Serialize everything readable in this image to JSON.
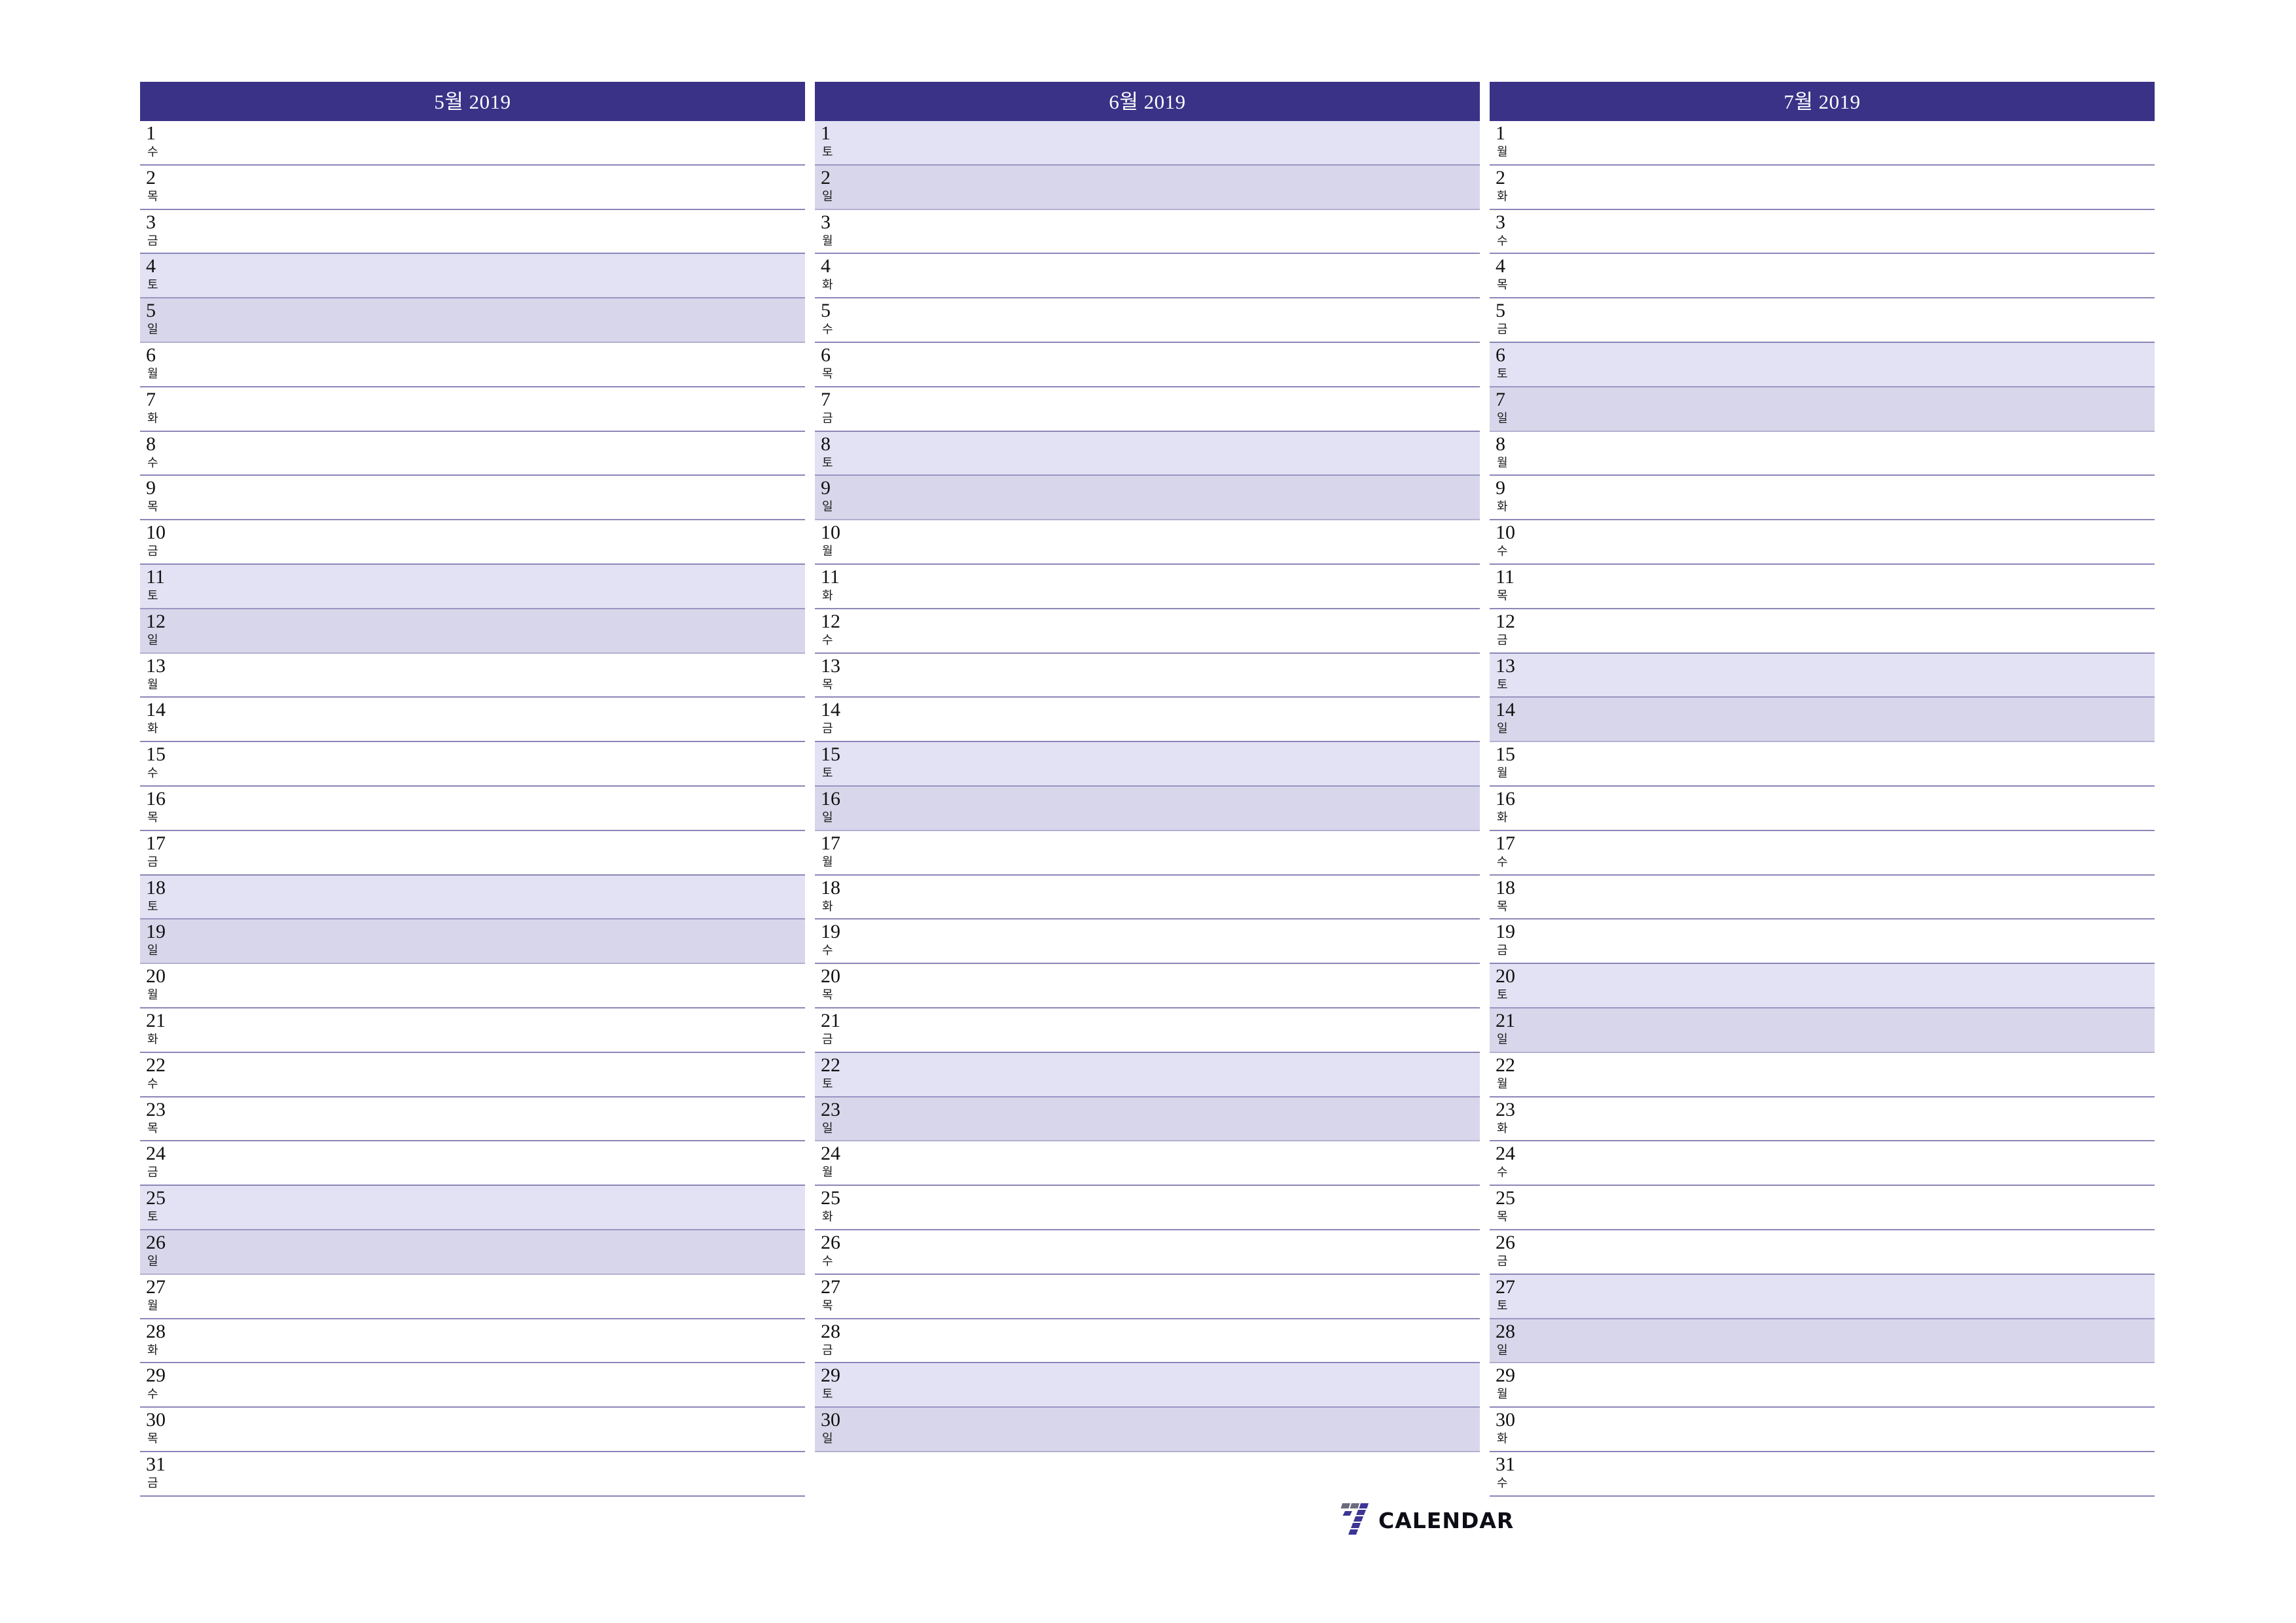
{
  "document": {
    "type": "calendar-planner",
    "layout": "three-month-columns",
    "weekday_labels": {
      "mon": "월",
      "tue": "화",
      "wed": "수",
      "thu": "목",
      "fri": "금",
      "sat": "토",
      "sun": "일"
    }
  },
  "colors": {
    "header_background": "#3a3287",
    "header_text": "#ffffff",
    "saturday_row": "#e2e2f4",
    "sunday_row": "#d8d6ea",
    "row_divider": "#8b86b8",
    "page_background": "#ffffff",
    "logo_purple": "#3d3596",
    "logo_gray": "#6b6b7d",
    "logo_text": "#0d0d16"
  },
  "months": [
    {
      "id": "may",
      "title": "5월 2019",
      "days": [
        {
          "num": "1",
          "wd": "수",
          "type": "weekday"
        },
        {
          "num": "2",
          "wd": "목",
          "type": "weekday"
        },
        {
          "num": "3",
          "wd": "금",
          "type": "weekday"
        },
        {
          "num": "4",
          "wd": "토",
          "type": "sat"
        },
        {
          "num": "5",
          "wd": "일",
          "type": "sun"
        },
        {
          "num": "6",
          "wd": "월",
          "type": "weekday"
        },
        {
          "num": "7",
          "wd": "화",
          "type": "weekday"
        },
        {
          "num": "8",
          "wd": "수",
          "type": "weekday"
        },
        {
          "num": "9",
          "wd": "목",
          "type": "weekday"
        },
        {
          "num": "10",
          "wd": "금",
          "type": "weekday"
        },
        {
          "num": "11",
          "wd": "토",
          "type": "sat"
        },
        {
          "num": "12",
          "wd": "일",
          "type": "sun"
        },
        {
          "num": "13",
          "wd": "월",
          "type": "weekday"
        },
        {
          "num": "14",
          "wd": "화",
          "type": "weekday"
        },
        {
          "num": "15",
          "wd": "수",
          "type": "weekday"
        },
        {
          "num": "16",
          "wd": "목",
          "type": "weekday"
        },
        {
          "num": "17",
          "wd": "금",
          "type": "weekday"
        },
        {
          "num": "18",
          "wd": "토",
          "type": "sat"
        },
        {
          "num": "19",
          "wd": "일",
          "type": "sun"
        },
        {
          "num": "20",
          "wd": "월",
          "type": "weekday"
        },
        {
          "num": "21",
          "wd": "화",
          "type": "weekday"
        },
        {
          "num": "22",
          "wd": "수",
          "type": "weekday"
        },
        {
          "num": "23",
          "wd": "목",
          "type": "weekday"
        },
        {
          "num": "24",
          "wd": "금",
          "type": "weekday"
        },
        {
          "num": "25",
          "wd": "토",
          "type": "sat"
        },
        {
          "num": "26",
          "wd": "일",
          "type": "sun"
        },
        {
          "num": "27",
          "wd": "월",
          "type": "weekday"
        },
        {
          "num": "28",
          "wd": "화",
          "type": "weekday"
        },
        {
          "num": "29",
          "wd": "수",
          "type": "weekday"
        },
        {
          "num": "30",
          "wd": "목",
          "type": "weekday"
        },
        {
          "num": "31",
          "wd": "금",
          "type": "weekday"
        }
      ]
    },
    {
      "id": "june",
      "title": "6월 2019",
      "days": [
        {
          "num": "1",
          "wd": "토",
          "type": "sat"
        },
        {
          "num": "2",
          "wd": "일",
          "type": "sun"
        },
        {
          "num": "3",
          "wd": "월",
          "type": "weekday"
        },
        {
          "num": "4",
          "wd": "화",
          "type": "weekday"
        },
        {
          "num": "5",
          "wd": "수",
          "type": "weekday"
        },
        {
          "num": "6",
          "wd": "목",
          "type": "weekday"
        },
        {
          "num": "7",
          "wd": "금",
          "type": "weekday"
        },
        {
          "num": "8",
          "wd": "토",
          "type": "sat"
        },
        {
          "num": "9",
          "wd": "일",
          "type": "sun"
        },
        {
          "num": "10",
          "wd": "월",
          "type": "weekday"
        },
        {
          "num": "11",
          "wd": "화",
          "type": "weekday"
        },
        {
          "num": "12",
          "wd": "수",
          "type": "weekday"
        },
        {
          "num": "13",
          "wd": "목",
          "type": "weekday"
        },
        {
          "num": "14",
          "wd": "금",
          "type": "weekday"
        },
        {
          "num": "15",
          "wd": "토",
          "type": "sat"
        },
        {
          "num": "16",
          "wd": "일",
          "type": "sun"
        },
        {
          "num": "17",
          "wd": "월",
          "type": "weekday"
        },
        {
          "num": "18",
          "wd": "화",
          "type": "weekday"
        },
        {
          "num": "19",
          "wd": "수",
          "type": "weekday"
        },
        {
          "num": "20",
          "wd": "목",
          "type": "weekday"
        },
        {
          "num": "21",
          "wd": "금",
          "type": "weekday"
        },
        {
          "num": "22",
          "wd": "토",
          "type": "sat"
        },
        {
          "num": "23",
          "wd": "일",
          "type": "sun"
        },
        {
          "num": "24",
          "wd": "월",
          "type": "weekday"
        },
        {
          "num": "25",
          "wd": "화",
          "type": "weekday"
        },
        {
          "num": "26",
          "wd": "수",
          "type": "weekday"
        },
        {
          "num": "27",
          "wd": "목",
          "type": "weekday"
        },
        {
          "num": "28",
          "wd": "금",
          "type": "weekday"
        },
        {
          "num": "29",
          "wd": "토",
          "type": "sat"
        },
        {
          "num": "30",
          "wd": "일",
          "type": "sun"
        }
      ]
    },
    {
      "id": "july",
      "title": "7월 2019",
      "days": [
        {
          "num": "1",
          "wd": "월",
          "type": "weekday"
        },
        {
          "num": "2",
          "wd": "화",
          "type": "weekday"
        },
        {
          "num": "3",
          "wd": "수",
          "type": "weekday"
        },
        {
          "num": "4",
          "wd": "목",
          "type": "weekday"
        },
        {
          "num": "5",
          "wd": "금",
          "type": "weekday"
        },
        {
          "num": "6",
          "wd": "토",
          "type": "sat"
        },
        {
          "num": "7",
          "wd": "일",
          "type": "sun"
        },
        {
          "num": "8",
          "wd": "월",
          "type": "weekday"
        },
        {
          "num": "9",
          "wd": "화",
          "type": "weekday"
        },
        {
          "num": "10",
          "wd": "수",
          "type": "weekday"
        },
        {
          "num": "11",
          "wd": "목",
          "type": "weekday"
        },
        {
          "num": "12",
          "wd": "금",
          "type": "weekday"
        },
        {
          "num": "13",
          "wd": "토",
          "type": "sat"
        },
        {
          "num": "14",
          "wd": "일",
          "type": "sun"
        },
        {
          "num": "15",
          "wd": "월",
          "type": "weekday"
        },
        {
          "num": "16",
          "wd": "화",
          "type": "weekday"
        },
        {
          "num": "17",
          "wd": "수",
          "type": "weekday"
        },
        {
          "num": "18",
          "wd": "목",
          "type": "weekday"
        },
        {
          "num": "19",
          "wd": "금",
          "type": "weekday"
        },
        {
          "num": "20",
          "wd": "토",
          "type": "sat"
        },
        {
          "num": "21",
          "wd": "일",
          "type": "sun"
        },
        {
          "num": "22",
          "wd": "월",
          "type": "weekday"
        },
        {
          "num": "23",
          "wd": "화",
          "type": "weekday"
        },
        {
          "num": "24",
          "wd": "수",
          "type": "weekday"
        },
        {
          "num": "25",
          "wd": "목",
          "type": "weekday"
        },
        {
          "num": "26",
          "wd": "금",
          "type": "weekday"
        },
        {
          "num": "27",
          "wd": "토",
          "type": "sat"
        },
        {
          "num": "28",
          "wd": "일",
          "type": "sun"
        },
        {
          "num": "29",
          "wd": "월",
          "type": "weekday"
        },
        {
          "num": "30",
          "wd": "화",
          "type": "weekday"
        },
        {
          "num": "31",
          "wd": "수",
          "type": "weekday"
        }
      ]
    }
  ],
  "logo": {
    "mark": "seven-stripes-icon",
    "text": "CALENDAR"
  }
}
